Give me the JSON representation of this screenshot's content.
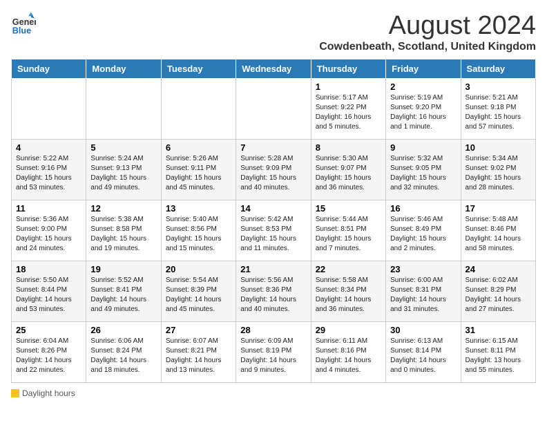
{
  "logo": {
    "general": "General",
    "blue": "Blue"
  },
  "title": "August 2024",
  "subtitle": "Cowdenbeath, Scotland, United Kingdom",
  "weekdays": [
    "Sunday",
    "Monday",
    "Tuesday",
    "Wednesday",
    "Thursday",
    "Friday",
    "Saturday"
  ],
  "legend": {
    "label": "Daylight hours"
  },
  "weeks": [
    [
      {
        "day": "",
        "info": ""
      },
      {
        "day": "",
        "info": ""
      },
      {
        "day": "",
        "info": ""
      },
      {
        "day": "",
        "info": ""
      },
      {
        "day": "1",
        "info": "Sunrise: 5:17 AM\nSunset: 9:22 PM\nDaylight: 16 hours\nand 5 minutes."
      },
      {
        "day": "2",
        "info": "Sunrise: 5:19 AM\nSunset: 9:20 PM\nDaylight: 16 hours\nand 1 minute."
      },
      {
        "day": "3",
        "info": "Sunrise: 5:21 AM\nSunset: 9:18 PM\nDaylight: 15 hours\nand 57 minutes."
      }
    ],
    [
      {
        "day": "4",
        "info": "Sunrise: 5:22 AM\nSunset: 9:16 PM\nDaylight: 15 hours\nand 53 minutes."
      },
      {
        "day": "5",
        "info": "Sunrise: 5:24 AM\nSunset: 9:13 PM\nDaylight: 15 hours\nand 49 minutes."
      },
      {
        "day": "6",
        "info": "Sunrise: 5:26 AM\nSunset: 9:11 PM\nDaylight: 15 hours\nand 45 minutes."
      },
      {
        "day": "7",
        "info": "Sunrise: 5:28 AM\nSunset: 9:09 PM\nDaylight: 15 hours\nand 40 minutes."
      },
      {
        "day": "8",
        "info": "Sunrise: 5:30 AM\nSunset: 9:07 PM\nDaylight: 15 hours\nand 36 minutes."
      },
      {
        "day": "9",
        "info": "Sunrise: 5:32 AM\nSunset: 9:05 PM\nDaylight: 15 hours\nand 32 minutes."
      },
      {
        "day": "10",
        "info": "Sunrise: 5:34 AM\nSunset: 9:02 PM\nDaylight: 15 hours\nand 28 minutes."
      }
    ],
    [
      {
        "day": "11",
        "info": "Sunrise: 5:36 AM\nSunset: 9:00 PM\nDaylight: 15 hours\nand 24 minutes."
      },
      {
        "day": "12",
        "info": "Sunrise: 5:38 AM\nSunset: 8:58 PM\nDaylight: 15 hours\nand 19 minutes."
      },
      {
        "day": "13",
        "info": "Sunrise: 5:40 AM\nSunset: 8:56 PM\nDaylight: 15 hours\nand 15 minutes."
      },
      {
        "day": "14",
        "info": "Sunrise: 5:42 AM\nSunset: 8:53 PM\nDaylight: 15 hours\nand 11 minutes."
      },
      {
        "day": "15",
        "info": "Sunrise: 5:44 AM\nSunset: 8:51 PM\nDaylight: 15 hours\nand 7 minutes."
      },
      {
        "day": "16",
        "info": "Sunrise: 5:46 AM\nSunset: 8:49 PM\nDaylight: 15 hours\nand 2 minutes."
      },
      {
        "day": "17",
        "info": "Sunrise: 5:48 AM\nSunset: 8:46 PM\nDaylight: 14 hours\nand 58 minutes."
      }
    ],
    [
      {
        "day": "18",
        "info": "Sunrise: 5:50 AM\nSunset: 8:44 PM\nDaylight: 14 hours\nand 53 minutes."
      },
      {
        "day": "19",
        "info": "Sunrise: 5:52 AM\nSunset: 8:41 PM\nDaylight: 14 hours\nand 49 minutes."
      },
      {
        "day": "20",
        "info": "Sunrise: 5:54 AM\nSunset: 8:39 PM\nDaylight: 14 hours\nand 45 minutes."
      },
      {
        "day": "21",
        "info": "Sunrise: 5:56 AM\nSunset: 8:36 PM\nDaylight: 14 hours\nand 40 minutes."
      },
      {
        "day": "22",
        "info": "Sunrise: 5:58 AM\nSunset: 8:34 PM\nDaylight: 14 hours\nand 36 minutes."
      },
      {
        "day": "23",
        "info": "Sunrise: 6:00 AM\nSunset: 8:31 PM\nDaylight: 14 hours\nand 31 minutes."
      },
      {
        "day": "24",
        "info": "Sunrise: 6:02 AM\nSunset: 8:29 PM\nDaylight: 14 hours\nand 27 minutes."
      }
    ],
    [
      {
        "day": "25",
        "info": "Sunrise: 6:04 AM\nSunset: 8:26 PM\nDaylight: 14 hours\nand 22 minutes."
      },
      {
        "day": "26",
        "info": "Sunrise: 6:06 AM\nSunset: 8:24 PM\nDaylight: 14 hours\nand 18 minutes."
      },
      {
        "day": "27",
        "info": "Sunrise: 6:07 AM\nSunset: 8:21 PM\nDaylight: 14 hours\nand 13 minutes."
      },
      {
        "day": "28",
        "info": "Sunrise: 6:09 AM\nSunset: 8:19 PM\nDaylight: 14 hours\nand 9 minutes."
      },
      {
        "day": "29",
        "info": "Sunrise: 6:11 AM\nSunset: 8:16 PM\nDaylight: 14 hours\nand 4 minutes."
      },
      {
        "day": "30",
        "info": "Sunrise: 6:13 AM\nSunset: 8:14 PM\nDaylight: 14 hours\nand 0 minutes."
      },
      {
        "day": "31",
        "info": "Sunrise: 6:15 AM\nSunset: 8:11 PM\nDaylight: 13 hours\nand 55 minutes."
      }
    ]
  ]
}
